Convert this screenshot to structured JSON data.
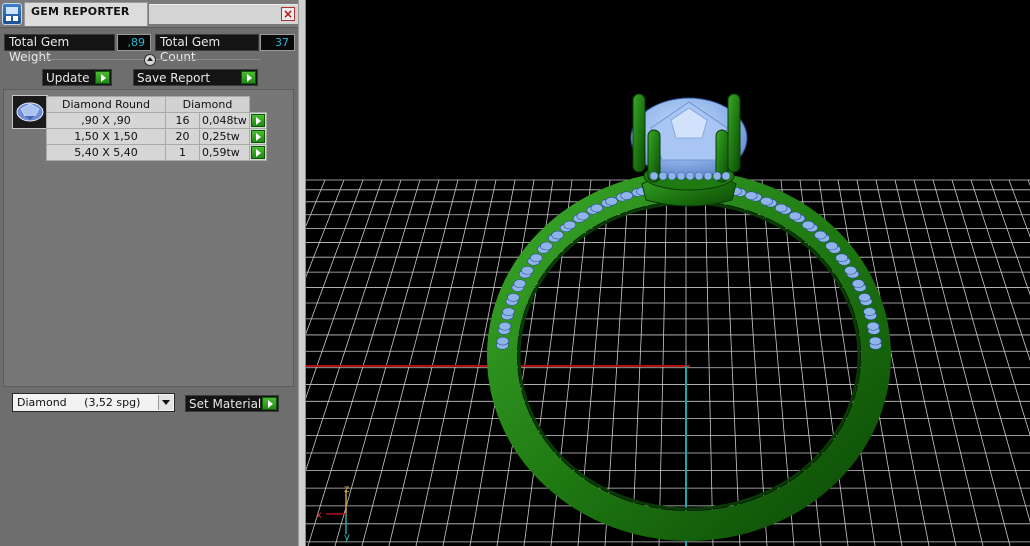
{
  "window": {
    "title": "GEM REPORTER",
    "app_icon": "app-logo-icon",
    "close_icon": "close-icon",
    "close_symbol": "×"
  },
  "summary": {
    "total_weight_label": "Total Gem Weight",
    "total_weight_value": ",89",
    "total_count_label": "Total Gem Count",
    "total_count_value": "37"
  },
  "toolbar": {
    "update_label": "Update",
    "save_report_label": "Save Report"
  },
  "report": {
    "gem_icon": "gem-thumbnail-icon",
    "headers": {
      "shape": "Diamond Round",
      "material": "Diamond"
    },
    "rows": [
      {
        "size": ",90 X ,90",
        "count": "16",
        "weight": "0,048tw"
      },
      {
        "size": "1,50 X 1,50",
        "count": "20",
        "weight": "0,25tw"
      },
      {
        "size": "5,40 X 5,40",
        "count": "1",
        "weight": "0,59tw"
      }
    ]
  },
  "material": {
    "selected": "Diamond     (3,52 spg)",
    "set_label": "Set Material"
  },
  "viewport": {
    "axis_labels": {
      "z": "z",
      "x": "x",
      "y": "y"
    },
    "colors": {
      "background": "#000000",
      "grid": "#c8c8c8",
      "ring_metal": "#1f7a12",
      "gem": "#8fb4ea",
      "x_axis": "#b01010",
      "y_axis": "#1fa8a8"
    }
  }
}
